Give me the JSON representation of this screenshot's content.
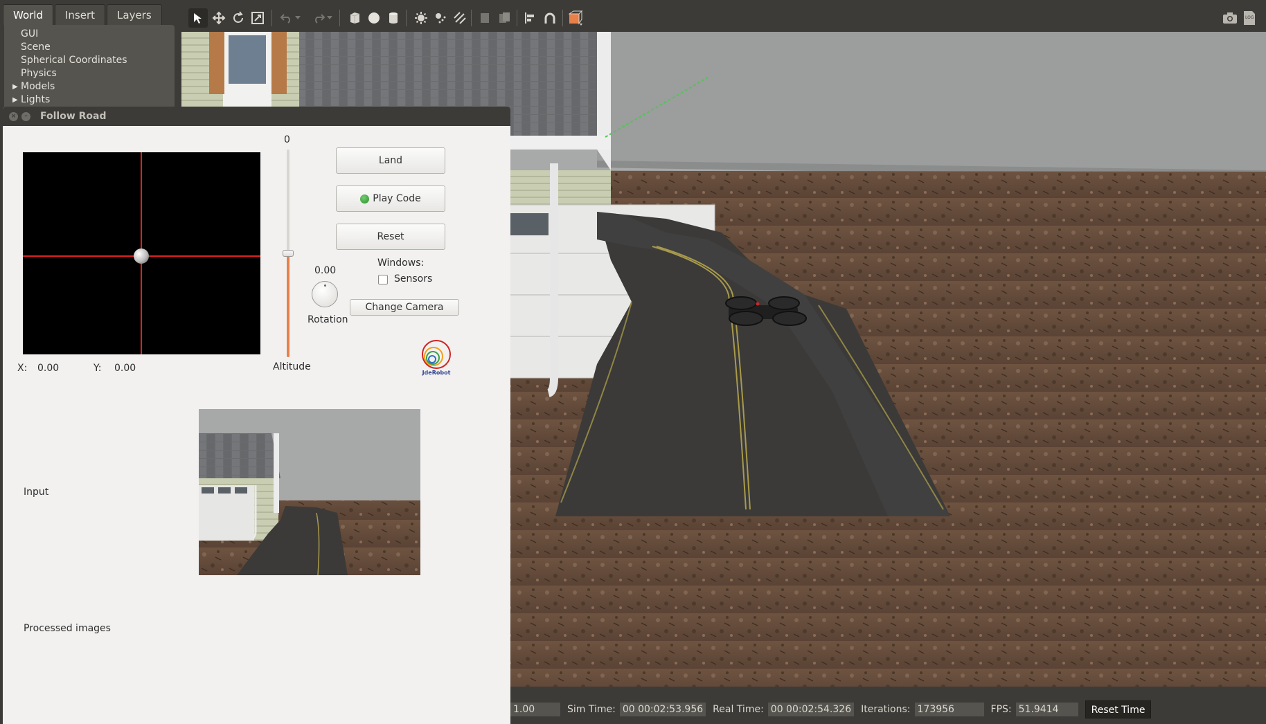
{
  "gazebo": {
    "tabs": [
      "World",
      "Insert",
      "Layers"
    ],
    "active_tab": "World",
    "tree": [
      {
        "label": "GUI",
        "expandable": false
      },
      {
        "label": "Scene",
        "expandable": false
      },
      {
        "label": "Spherical Coordinates",
        "expandable": false
      },
      {
        "label": "Physics",
        "expandable": false
      },
      {
        "label": "Models",
        "expandable": true
      },
      {
        "label": "Lights",
        "expandable": true
      }
    ],
    "toolbar_icons": [
      "select-arrow-icon",
      "translate-icon",
      "rotate-icon",
      "scale-icon",
      "undo-icon",
      "undo-dropdown-icon",
      "redo-icon",
      "redo-dropdown-icon",
      "box-icon",
      "sphere-icon",
      "cylinder-icon",
      "point-light-icon",
      "spot-light-icon",
      "directional-light-icon",
      "copy-icon",
      "paste-icon",
      "align-icon",
      "snap-icon",
      "view-angle-icon",
      "screenshot-icon",
      "log-icon"
    ],
    "status": {
      "rtf_value": "1.00",
      "sim_time_label": "Sim Time:",
      "sim_time": "00 00:02:53.956",
      "real_time_label": "Real Time:",
      "real_time": "00 00:02:54.326",
      "iterations_label": "Iterations:",
      "iterations": "173956",
      "fps_label": "FPS:",
      "fps": "51.9414",
      "reset_time": "Reset Time"
    }
  },
  "follow_road": {
    "window_title": "Follow Road",
    "altitude_top_value": "0",
    "altitude_label": "Altitude",
    "altitude_level": 0.5,
    "x_label": "X:",
    "x_value": "0.00",
    "y_label": "Y:",
    "y_value": "0.00",
    "buttons": {
      "land": "Land",
      "play_code": "Play Code",
      "reset": "Reset",
      "change_camera": "Change Camera"
    },
    "rotation_value": "0.00",
    "rotation_label": "Rotation",
    "windows_label": "Windows:",
    "sensors_label": "Sensors",
    "sensors_checked": false,
    "logo_text": "JdeRobot",
    "input_label": "Input",
    "processed_label": "Processed images"
  },
  "colors": {
    "accent_orange": "#e8804a",
    "crosshair_red": "#e02020",
    "play_green": "#2e8b2e"
  }
}
